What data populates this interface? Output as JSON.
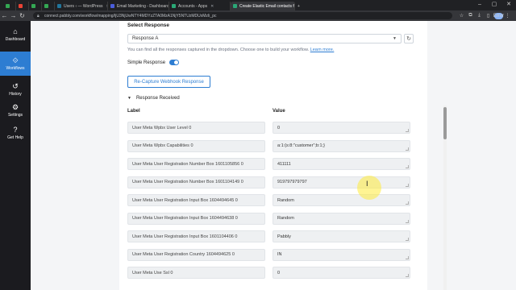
{
  "browser": {
    "tabs": [
      {
        "label": "",
        "color": "#34a853"
      },
      {
        "label": "",
        "color": "#ea4335"
      },
      {
        "label": "",
        "color": "#34a853"
      },
      {
        "label": "",
        "color": "#34a853"
      },
      {
        "label": "Users ‹ — WordPress",
        "color": "#21759b"
      },
      {
        "label": "Email Marketing - Dashboard",
        "color": "#4a5ddb"
      },
      {
        "label": "Accounts - Apps",
        "color": "#2aa876"
      },
      {
        "label": "Create Elastic Email contacts fo",
        "color": "#2aa876",
        "active": true
      }
    ],
    "url": "connect.pabbly.com/workflow/mapping/IjU3NjUwNTY4MDYzZTA0MzA1NjY5NTUzMDUxMzIi_pc",
    "profile": "Error"
  },
  "sidebar": {
    "items": [
      {
        "label": "Dashboard",
        "icon": "home-icon",
        "glyph": "⌂",
        "active": false
      },
      {
        "label": "Workflows",
        "icon": "workflow-icon",
        "glyph": "⟐",
        "active": true
      },
      {
        "label": "History",
        "icon": "history-icon",
        "glyph": "↺",
        "active": false
      },
      {
        "label": "Settings",
        "icon": "gear-icon",
        "glyph": "⚙",
        "active": false
      },
      {
        "label": "Get Help",
        "icon": "help-icon",
        "glyph": "?",
        "active": false
      }
    ]
  },
  "panel": {
    "select_title": "Select Response",
    "selected_response": "Response A",
    "help_text": "You can find all the responses captured in the dropdown. Choose one to build your workflow.",
    "help_link": "Learn more.",
    "simple_response_label": "Simple Response",
    "simple_response_on": true,
    "recapture_label": "Re-Capture Webhook Response",
    "response_received_label": "Response Received",
    "col_label": "Label",
    "col_value": "Value",
    "rows": [
      {
        "label": "User Meta Wpbx User Level 0",
        "value": "0"
      },
      {
        "label": "User Meta Wpbx Capabilities 0",
        "value": "a:1:{s:8:\"customer\";b:1;}"
      },
      {
        "label": "User Meta User Registration Number Box 1601105856 0",
        "value": "411111"
      },
      {
        "label": "User Meta User Registration Number Box 1601104149 0",
        "value": "919797979797"
      },
      {
        "label": "User Meta User Registration Input Box 1604494645 0",
        "value": "Random"
      },
      {
        "label": "User Meta User Registration Input Box 1604494638 0",
        "value": "Random"
      },
      {
        "label": "User Meta User Registration Input Box 1601104406 0",
        "value": "Pabbly"
      },
      {
        "label": "User Meta User Registration Country 1604494625 0",
        "value": "IN"
      },
      {
        "label": "User Meta Use Ssl 0",
        "value": "0"
      }
    ]
  },
  "colors": {
    "accent": "#2d7dd2",
    "sidebar_bg": "#1b1b1f"
  }
}
